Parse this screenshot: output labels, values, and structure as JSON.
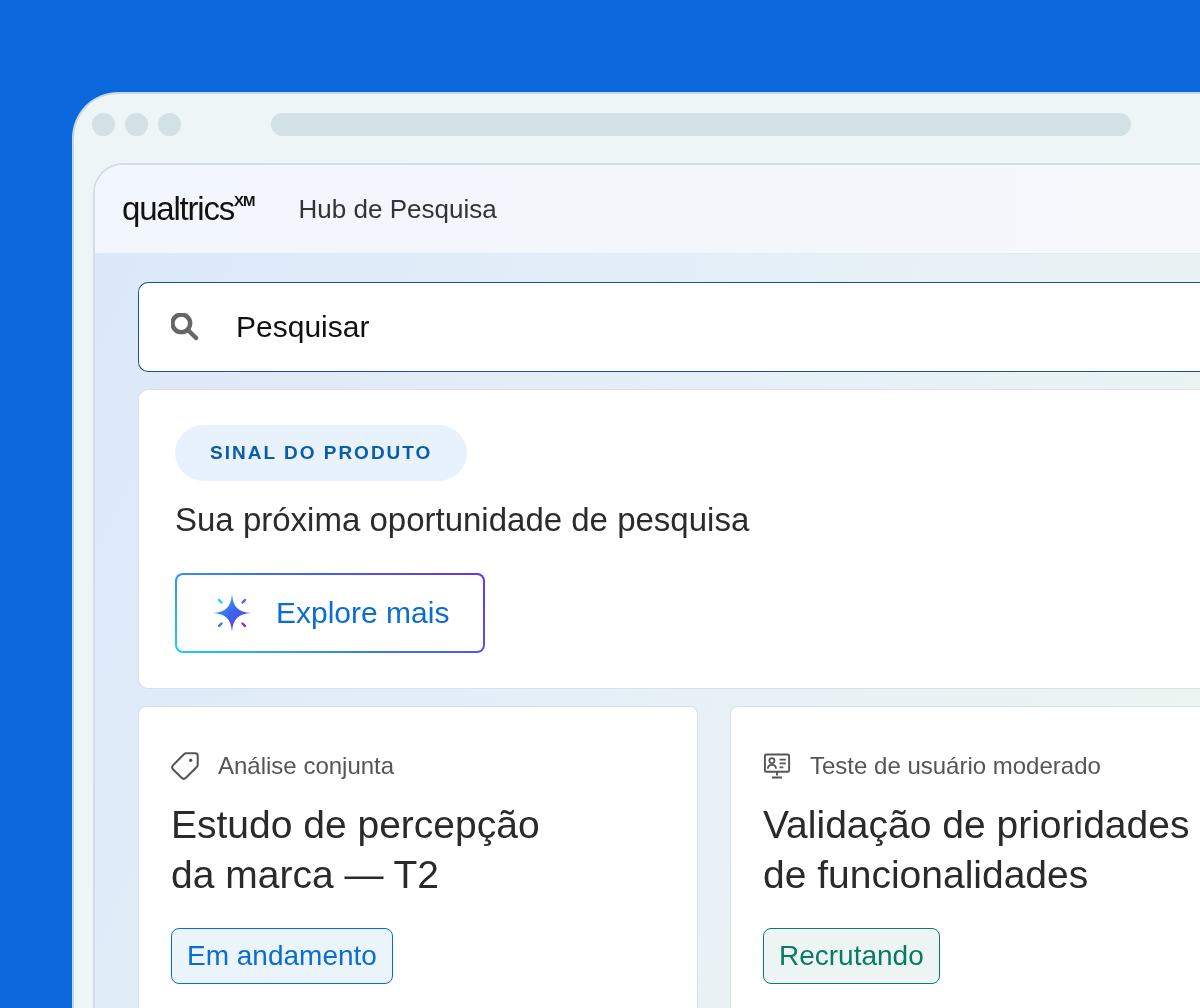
{
  "app": {
    "logo": "qualtrics$^{XM}$",
    "title": "Hub de Pesquisa"
  },
  "search": {
    "placeholder": "Pesquisar"
  },
  "signal_card": {
    "badge": "SINAL DO PRODUTO",
    "headline": "Sua próxima oportunidade de pesquisa",
    "button": "Explore mais"
  },
  "studies": [
    {
      "kind": "conjoint",
      "category": "Análise conjunta",
      "title": "Estudo de percepção\nda marca — T2",
      "status": {
        "label": "Em andamento",
        "color": "#0a6ed1"
      }
    },
    {
      "kind": "usertest",
      "category": "Teste de usuário moderado",
      "title": "Validação de prioridades\nde funcionalidades",
      "status": {
        "label": "Recrutando",
        "color": "#0b7a65"
      }
    }
  ]
}
